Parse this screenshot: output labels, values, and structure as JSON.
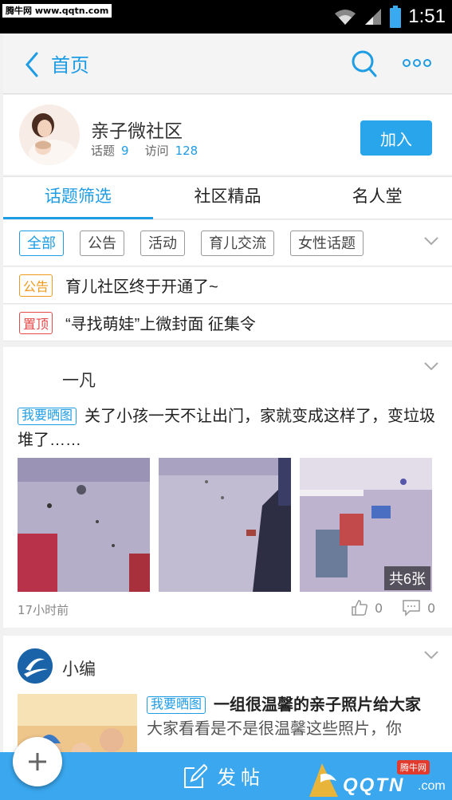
{
  "watermark": {
    "top_tag": "腾牛网 www.qqtn.com",
    "corner_badge": "腾牛网",
    "corner_text": "QQTN",
    "corner_suffix": ".com"
  },
  "status_bar": {
    "time": "1:51"
  },
  "header": {
    "title": "首页",
    "icons": [
      "back-chevron-icon",
      "search-icon",
      "more-icon"
    ]
  },
  "community": {
    "name": "亲子微社区",
    "topics_label": "话题",
    "topics_count": "9",
    "visits_label": "访问",
    "visits_count": "128",
    "join_label": "加入"
  },
  "tabs": [
    {
      "label": "话题筛选",
      "active": true
    },
    {
      "label": "社区精品",
      "active": false
    },
    {
      "label": "名人堂",
      "active": false
    }
  ],
  "filters": [
    {
      "label": "全部",
      "active": true
    },
    {
      "label": "公告",
      "active": false
    },
    {
      "label": "活动",
      "active": false
    },
    {
      "label": "育儿交流",
      "active": false
    },
    {
      "label": "女性话题",
      "active": false
    }
  ],
  "notices": [
    {
      "tag": "公告",
      "text": "育儿社区终于开通了~",
      "color": "#f09a1b"
    },
    {
      "tag": "置顶",
      "text": "“寻找萌娃”上微封面  征集令",
      "color": "#e54a4a"
    }
  ],
  "posts": [
    {
      "user": "一凡",
      "tag": "我要晒图",
      "text": "关了小孩一天不让出门，家就变成这样了，变垃圾堆了……",
      "photo_count_label": "共6张",
      "time": "17小时前",
      "likes": "0",
      "comments": "0"
    },
    {
      "user": "小编",
      "tag": "我要晒图",
      "title": "一组很温馨的亲子照片给大家",
      "preview": "大家看看是不是很温馨这些照片，你"
    }
  ],
  "bottom_bar": {
    "compose_label": "发帖"
  },
  "colors": {
    "accent": "#1e9ce4",
    "bottom_bar": "#3aa7ee",
    "join_button": "#29a5ec"
  }
}
